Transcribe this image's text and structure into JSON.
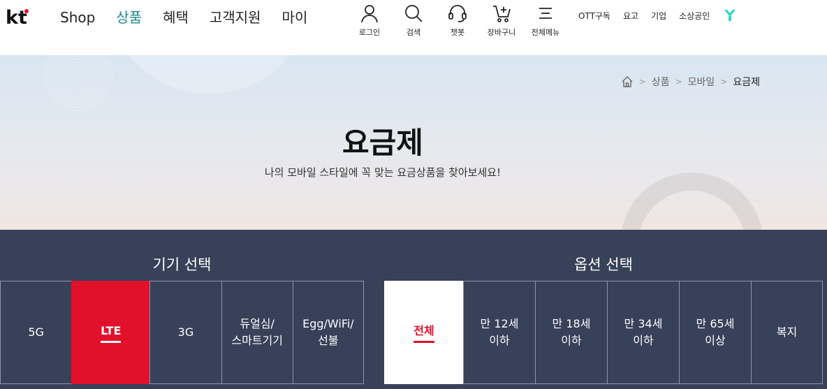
{
  "header": {
    "logo_text": "kt",
    "nav": [
      {
        "label": "Shop",
        "active": false
      },
      {
        "label": "상품",
        "active": true
      },
      {
        "label": "혜택",
        "active": false
      },
      {
        "label": "고객지원",
        "active": false
      },
      {
        "label": "마이",
        "active": false
      }
    ],
    "utils": [
      {
        "label": "로그인",
        "icon": "user-icon"
      },
      {
        "label": "검색",
        "icon": "search-icon"
      },
      {
        "label": "챗봇",
        "icon": "headset-icon"
      },
      {
        "label": "장바구니",
        "icon": "cart-icon"
      },
      {
        "label": "전체메뉴",
        "icon": "menu-icon"
      }
    ],
    "sublinks": [
      "OTT구독",
      "요고",
      "기업",
      "소상공인"
    ],
    "accent_color": "#1b8a8f",
    "brand_logo_icon": "y-brand-icon"
  },
  "hero": {
    "breadcrumb": [
      "상품",
      "모바일",
      "요금제"
    ],
    "title": "요금제",
    "subtitle": "나의 모바일 스타일에 꼭 맞는 요금상품을 찾아보세요!"
  },
  "selector": {
    "device_title": "기기 선택",
    "device_tabs": [
      {
        "label": "5G",
        "active": false
      },
      {
        "label": "LTE",
        "active": true
      },
      {
        "label": "3G",
        "active": false
      },
      {
        "label": "듀얼심/\n스마트기기",
        "active": false
      },
      {
        "label": "Egg/WiFi/\n선불",
        "active": false
      }
    ],
    "option_title": "옵션 선택",
    "option_tabs": [
      {
        "label": "전체",
        "active": true
      },
      {
        "label": "만 12세\n이하",
        "active": false
      },
      {
        "label": "만 18세\n이하",
        "active": false
      },
      {
        "label": "만 34세\n이하",
        "active": false
      },
      {
        "label": "만 65세\n이상",
        "active": false
      },
      {
        "label": "복지",
        "active": false
      }
    ],
    "bg_color": "#374158",
    "active_color": "#e2102b"
  }
}
